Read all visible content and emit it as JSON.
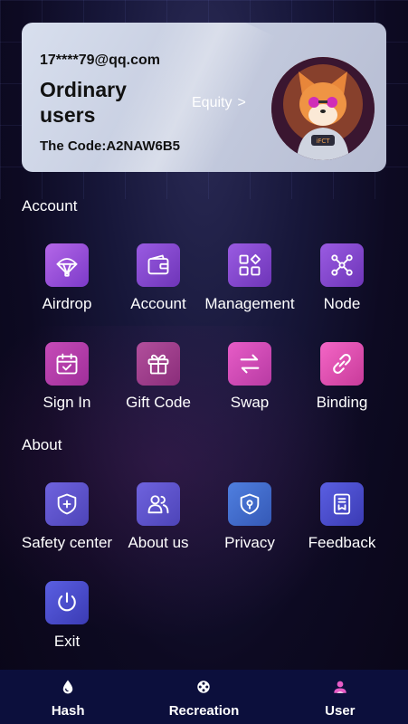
{
  "profile": {
    "email": "17****79@qq.com",
    "level": "Ordinary users",
    "code": "The Code:A2NAW6B5",
    "equity_label": "Equity",
    "equity_chevron": ">"
  },
  "sections": {
    "account_title": "Account",
    "about_title": "About"
  },
  "account_items": [
    {
      "label": "Airdrop",
      "icon": "parachute-icon"
    },
    {
      "label": "Account",
      "icon": "wallet-icon"
    },
    {
      "label": "Management",
      "icon": "apps-grid-icon"
    },
    {
      "label": "Node",
      "icon": "node-network-icon"
    },
    {
      "label": "Sign In",
      "icon": "calendar-check-icon"
    },
    {
      "label": "Gift Code",
      "icon": "gift-icon"
    },
    {
      "label": "Swap",
      "icon": "swap-arrows-icon"
    },
    {
      "label": "Binding",
      "icon": "link-icon"
    }
  ],
  "about_items": [
    {
      "label": "Safety center",
      "icon": "shield-plus-icon"
    },
    {
      "label": "About us",
      "icon": "users-icon"
    },
    {
      "label": "Privacy",
      "icon": "privacy-shield-icon"
    },
    {
      "label": "Feedback",
      "icon": "feedback-document-icon"
    },
    {
      "label": "Exit",
      "icon": "power-icon"
    }
  ],
  "bottom_nav": [
    {
      "label": "Hash",
      "icon": "drop-icon"
    },
    {
      "label": "Recreation",
      "icon": "film-reel-icon"
    },
    {
      "label": "User",
      "icon": "user-icon",
      "active": true
    }
  ],
  "colors": {
    "accent_pink": "#e75cc7",
    "nav_bg": "#0c0f3c",
    "card_bg": "#c6cde0"
  }
}
